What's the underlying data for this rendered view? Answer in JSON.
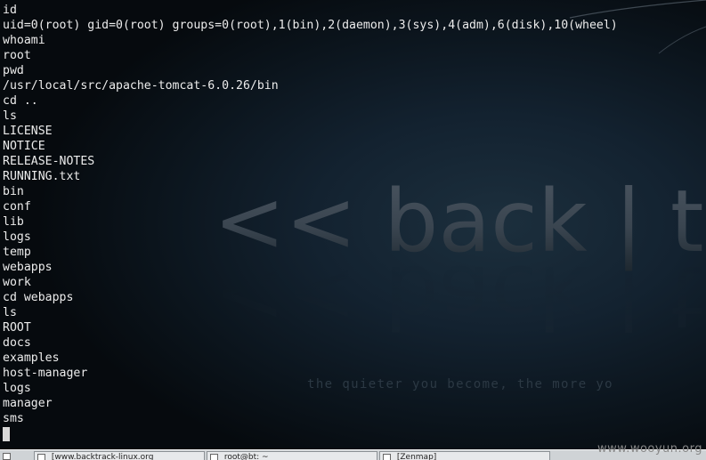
{
  "terminal": {
    "lines": [
      "id",
      "uid=0(root) gid=0(root) groups=0(root),1(bin),2(daemon),3(sys),4(adm),6(disk),10(wheel)",
      "whoami",
      "root",
      "pwd",
      "/usr/local/src/apache-tomcat-6.0.26/bin",
      "cd ..",
      "ls",
      "LICENSE",
      "NOTICE",
      "RELEASE-NOTES",
      "RUNNING.txt",
      "bin",
      "conf",
      "lib",
      "logs",
      "temp",
      "webapps",
      "work",
      "cd webapps",
      "ls",
      "ROOT",
      "docs",
      "examples",
      "host-manager",
      "logs",
      "manager",
      "sms"
    ],
    "text_color": "#ececec",
    "cursor_color": "#d8d8d8"
  },
  "wallpaper": {
    "logo_text": "<< back | tra",
    "tagline": "the quieter you become, the more yo",
    "background_color": "#0b141c",
    "logo_color": "#3a4550"
  },
  "watermark": "www.wooyun.org",
  "taskbar": {
    "items": [
      {
        "label": "[www.backtrack-linux.org",
        "icon": "browser-icon"
      },
      {
        "label": "root@bt: ~",
        "icon": "terminal-icon"
      },
      {
        "label": "[Zenmap]",
        "icon": "window-icon"
      }
    ],
    "background_color": "#cfd3d6"
  }
}
